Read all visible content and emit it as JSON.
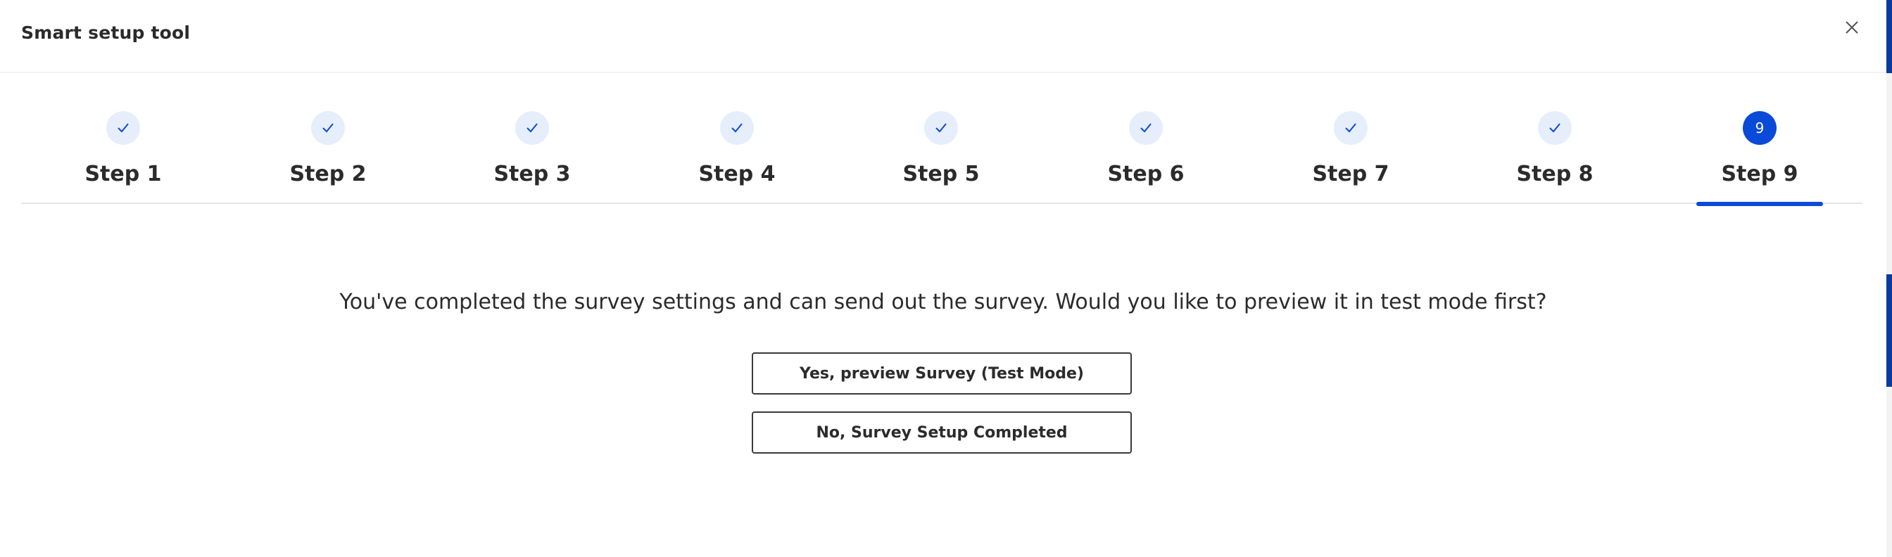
{
  "dialog": {
    "title": "Smart setup tool",
    "close_icon": "close-icon"
  },
  "stepper": {
    "current_step": 9,
    "accent_color": "#0a4ad8",
    "completed_bg": "#e6eefc",
    "steps": [
      {
        "label": "Step 1",
        "status": "completed",
        "icon": "check-icon"
      },
      {
        "label": "Step 2",
        "status": "completed",
        "icon": "check-icon"
      },
      {
        "label": "Step 3",
        "status": "completed",
        "icon": "check-icon"
      },
      {
        "label": "Step 4",
        "status": "completed",
        "icon": "check-icon"
      },
      {
        "label": "Step 5",
        "status": "completed",
        "icon": "check-icon"
      },
      {
        "label": "Step 6",
        "status": "completed",
        "icon": "check-icon"
      },
      {
        "label": "Step 7",
        "status": "completed",
        "icon": "check-icon"
      },
      {
        "label": "Step 8",
        "status": "completed",
        "icon": "check-icon"
      },
      {
        "label": "Step 9",
        "status": "active",
        "number": "9"
      }
    ]
  },
  "content": {
    "question": "You've completed the survey settings and can send out the survey. Would you like to preview it in test mode first?",
    "preview_button": "Yes, preview Survey (Test Mode)",
    "complete_button": "No, Survey Setup Completed"
  }
}
